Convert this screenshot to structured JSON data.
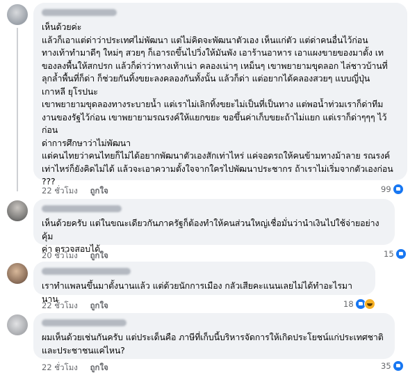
{
  "comments": [
    {
      "text": "เห็นด้วยค่ะ\nแล้วก็เอาแต่ด่าว่าประเทศไม่พัฒนา แต่ไม่คิดจะพัฒนาตัวเอง เห็นแก่ตัว แต่ด่าคนอื่นไว้ก่อน\nทางเท้าทำมาดีๆ ใหม่ๆ สวยๆ ก็เอารถขึ้นไปวิ่งให้มันพัง เอาร้านอาหาร เอาแผงขายของมาตั้ง เท\nของลงพื้นให้สกปรก แล้วก็ด่าว่าทางเท้าเน่า คลองเน่าๆ เหม็นๆ เขาพยายามขุดลอก ไล่ชาวบ้านที่\nลุกล้ำพื้นที่ก็ด่า ก็ช่วยกันทิ้งขยะลงคลองกันทั้งนั้น แล้วก็ด่า แต่อยากได้คลองสวยๆ แบบญี่ปุ่น\nเกาหลี ยุโรปนะ\nเขาพยายามขุดลองทางระบายน้ำ แต่เราไม่เลิกทิ้งขยะไม่เป็นที่เป็นทาง แต่พอน้ำท่วมเราก็ด่าทีม\nงานของรัฐไว้ก่อน เขาพยายามรณรงค์ให้แยกขยะ ขอขึ้นค่าเก็บขยะถ้าไม่แยก แต่เราก็ด่าๆๆๆ ไว้\nก่อน\nด่าการศึกษาว่าไม่พัฒนา\nแต่คนไทยว่าคนไทยก็ไม่ได้อยากพัฒนาตัวเองสักเท่าไหร่ แค่จอดรถให้คนข้ามทางม้าลาย รณรงค์\nเท่าไหร่ก็ยังคิดไม่ได้ แล้วจะเอาความตั้งใจจากใครไปพัฒนาประชากร ถ้าเราไม่เริ่มจากตัวเองก่อน\n???",
      "time": "22 ชั่วโมง",
      "like_label": "ถูกใจ",
      "reply_label": "",
      "reaction_count": "99",
      "avatar_color": "#9aa0a8"
    },
    {
      "text": "เห็นด้วยครับ แต่ในขณะเดียวกันภาครัฐก็ต้องทำให้คนส่วนใหญ่เชื่อมั่นว่านำเงินไปใช้จ่ายอย่างคุ้ม\nค่า ตรวจสอบได้",
      "time": "20 ชั่วโมง",
      "like_label": "ถูกใจ",
      "reaction_count": "15",
      "avatar_color": "#7d7c7a"
    },
    {
      "text": "เราทำแพลนขึ้นมาตั้งนานแล้ว แต่ด้วยนักการเมือง กลัวเสียคะแนนเลยไม่ได้ทำอะไรมานาน",
      "time": "22 ชั่วโมง",
      "like_label": "ถูกใจ",
      "reaction_count": "18",
      "avatar_color": "#8c6f5a"
    },
    {
      "text": "ผมเห็นด้วยเช่นกันครับ แต่ประเด็นคือ ภาษีที่เก็บนี้บริหารจัดการให้เกิดประโยชน์แก่ประเทศชาติ\nและประชาชนแค่ไหน?",
      "time": "22 ชั่วโมง",
      "like_label": "ถูกใจ",
      "reaction_count": "35",
      "avatar_color": "#a7a9ad"
    }
  ],
  "colors": {
    "bubble": "#f0f2f5",
    "meta": "#65676b",
    "like_blue": "#1877f2"
  },
  "icons": [
    "like-reaction-icon",
    "haha-reaction-icon"
  ]
}
